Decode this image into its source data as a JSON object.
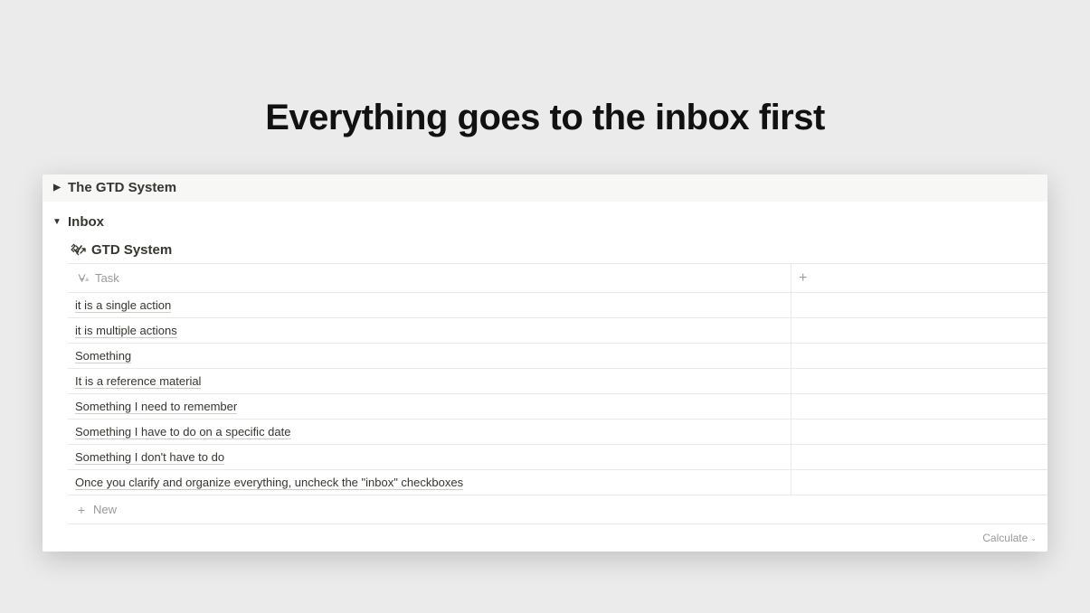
{
  "page": {
    "title": "Everything goes to the inbox first"
  },
  "toggles": {
    "gtd_system": "The GTD System",
    "inbox": "Inbox"
  },
  "database": {
    "title": "GTD System",
    "column_header": "Task",
    "rows": [
      "it is a single action",
      "it is multiple actions",
      "Something",
      "It is a reference material",
      "Something I need to remember",
      "Something I have to do on a specific date",
      "Something I don't have to do",
      "Once you clarify and organize everything, uncheck the \"inbox\" checkboxes"
    ],
    "new_label": "New",
    "calculate_label": "Calculate"
  }
}
